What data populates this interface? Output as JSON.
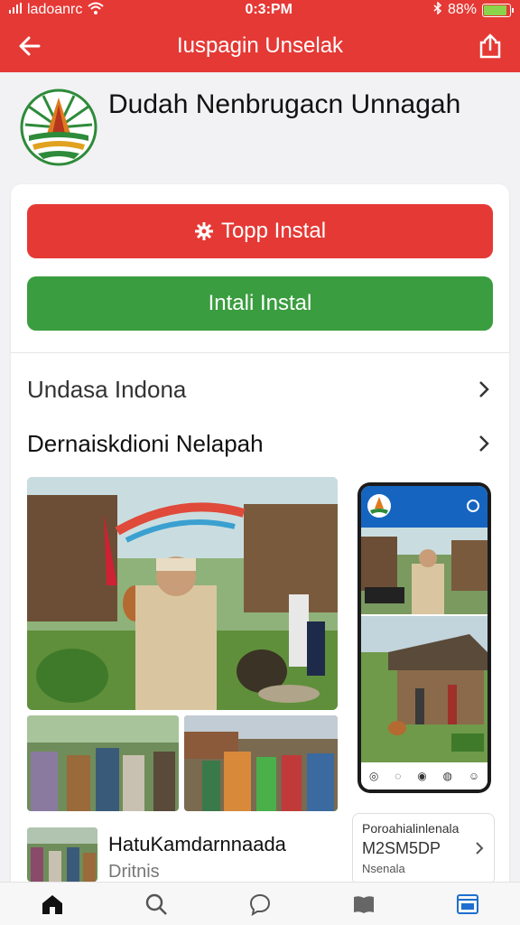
{
  "status_bar": {
    "carrier": "ladoanrc",
    "time": "0:3:PM",
    "battery": "88%",
    "battery_level": 0.88
  },
  "app_bar": {
    "title": "Iuspagin Unselak",
    "back_icon": "arrow-left-icon",
    "share_icon": "share-icon"
  },
  "app": {
    "name": "Dudah Nenbrugacn Unnagah"
  },
  "actions": {
    "primary_label": "Topp Instal",
    "secondary_label": "Intali Instal",
    "primary_color": "#e53935",
    "secondary_color": "#3a9d3f"
  },
  "rows": [
    {
      "label": "Undasa Indona"
    },
    {
      "label": "Dernaiskdioni Nelapah"
    }
  ],
  "related": {
    "title": "HatuKamdarnnaada",
    "subtitle": "Dritnis"
  },
  "info_box": {
    "line1": "Poroahialinlenala",
    "line2": "M2SM5DP",
    "line3": "Nsenala"
  },
  "nav": {
    "items": [
      {
        "icon": "home-icon"
      },
      {
        "icon": "search-icon"
      },
      {
        "icon": "chat-icon"
      },
      {
        "icon": "book-icon"
      },
      {
        "icon": "app-window-icon"
      }
    ]
  },
  "accent_color": "#e53935"
}
